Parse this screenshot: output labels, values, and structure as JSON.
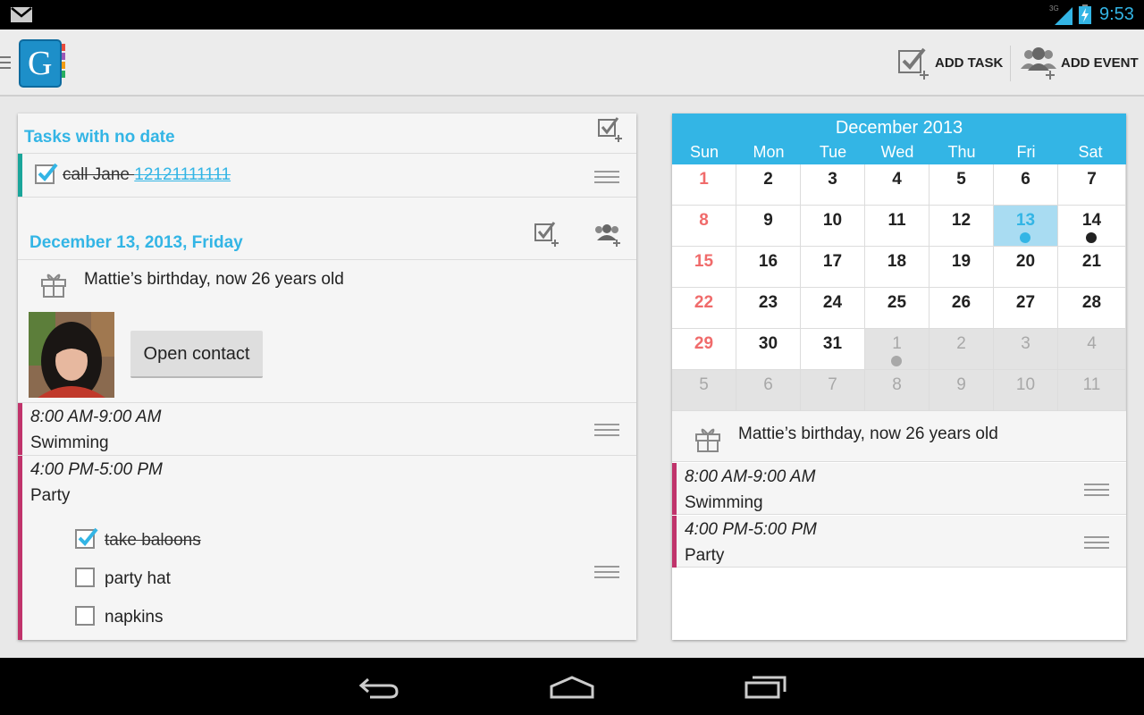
{
  "status_bar": {
    "time": "9:53",
    "network": "3G"
  },
  "action_bar": {
    "app_logo_letter": "G",
    "add_task_label": "ADD TASK",
    "add_event_label": "ADD EVENT"
  },
  "tasks_no_date": {
    "title": "Tasks with no date",
    "task": {
      "text": "call Jane ",
      "phone": "12121111111",
      "checked": true
    }
  },
  "day_section": {
    "title": "December 13, 2013, Friday",
    "birthday": "Mattie’s birthday, now 26 years old",
    "open_contact_label": "Open contact",
    "events": [
      {
        "time": "8:00 AM-9:00 AM",
        "name": "Swimming",
        "color": "#c0336b"
      },
      {
        "time": "4:00 PM-5:00 PM",
        "name": "Party",
        "color": "#c0336b"
      }
    ],
    "subtasks": [
      {
        "label": "take baloons",
        "checked": true
      },
      {
        "label": "party hat",
        "checked": false
      },
      {
        "label": "napkins",
        "checked": false
      }
    ]
  },
  "calendar": {
    "month_title": "December 2013",
    "weekdays": [
      "Sun",
      "Mon",
      "Tue",
      "Wed",
      "Thu",
      "Fri",
      "Sat"
    ],
    "weeks": [
      [
        "1",
        "2",
        "3",
        "4",
        "5",
        "6",
        "7"
      ],
      [
        "8",
        "9",
        "10",
        "11",
        "12",
        "13",
        "14"
      ],
      [
        "15",
        "16",
        "17",
        "18",
        "19",
        "20",
        "21"
      ],
      [
        "22",
        "23",
        "24",
        "25",
        "26",
        "27",
        "28"
      ],
      [
        "29",
        "30",
        "31",
        "1",
        "2",
        "3",
        "4"
      ],
      [
        "5",
        "6",
        "7",
        "8",
        "9",
        "10",
        "11"
      ]
    ],
    "selected_day": "13",
    "colors": {
      "accent": "#33b5e5",
      "sunday": "#f06b6b",
      "event": "#c0336b"
    }
  },
  "right_list": {
    "birthday": "Mattie’s birthday, now 26 years old",
    "events": [
      {
        "time": "8:00 AM-9:00 AM",
        "name": "Swimming"
      },
      {
        "time": "4:00 PM-5:00 PM",
        "name": "Party"
      }
    ]
  }
}
